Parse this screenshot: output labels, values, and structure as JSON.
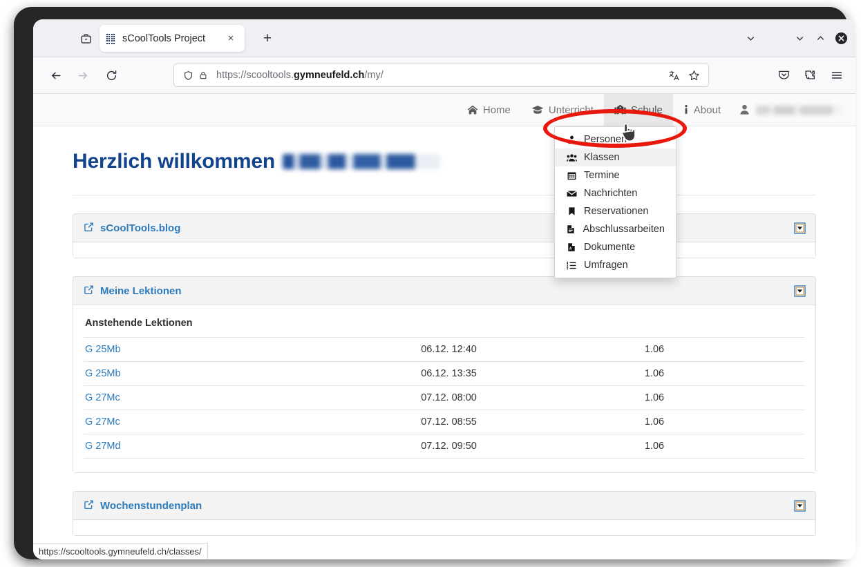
{
  "browser": {
    "tab": {
      "title": "sCoolTools Project",
      "favicon": "grid-favicon",
      "close_label": "×"
    },
    "new_tab_label": "+",
    "url": {
      "scheme": "https://scooltools.",
      "domain": "gymneufeld.ch",
      "path": "/my/"
    },
    "url_full": "https://scooltools.gymneufeld.ch/my/",
    "icons": {
      "tab_list": "chevron-down-icon",
      "minimize": "chevron-down-icon",
      "maximize": "chevron-up-icon",
      "close": "close-icon",
      "back": "arrow-left-icon",
      "forward": "arrow-right-icon",
      "reload": "reload-icon",
      "shield": "shield-icon",
      "lock": "lock-icon",
      "translate": "translate-icon",
      "bookmark": "star-icon",
      "pocket": "pocket-icon",
      "extensions": "extensions-icon",
      "menu": "hamburger-menu-icon"
    }
  },
  "site_nav": {
    "items": [
      {
        "label": "Home",
        "icon": "home-icon",
        "active": false
      },
      {
        "label": "Unterricht",
        "icon": "graduation-cap-icon",
        "active": false
      },
      {
        "label": "Schule",
        "icon": "school-icon",
        "active": true
      },
      {
        "label": "About",
        "icon": "info-icon",
        "active": false
      }
    ],
    "user": {
      "icon": "user-icon",
      "name_redacted": true
    }
  },
  "dropdown": {
    "open_for": "Schule",
    "items": [
      {
        "label": "Personen",
        "icon": "person-icon",
        "highlighted": false
      },
      {
        "label": "Klassen",
        "icon": "group-icon",
        "highlighted": true
      },
      {
        "label": "Termine",
        "icon": "calendar-icon",
        "highlighted": false
      },
      {
        "label": "Nachrichten",
        "icon": "envelope-icon",
        "highlighted": false
      },
      {
        "label": "Reservationen",
        "icon": "bookmark-icon",
        "highlighted": false
      },
      {
        "label": "Abschlussarbeiten",
        "icon": "file-text-icon",
        "highlighted": false
      },
      {
        "label": "Dokumente",
        "icon": "file-pdf-icon",
        "highlighted": false
      },
      {
        "label": "Umfragen",
        "icon": "list-ol-icon",
        "highlighted": false
      }
    ]
  },
  "page": {
    "welcome_prefix": "Herzlich willkommen",
    "welcome_name_redacted": true,
    "panels": [
      {
        "title": "sCoolTools.blog",
        "icon": "external-link-icon",
        "collapse_icon": "caret-down-box-icon"
      },
      {
        "title": "Meine Lektionen",
        "icon": "external-link-icon",
        "collapse_icon": "caret-down-box-icon"
      },
      {
        "title": "Wochenstundenplan",
        "icon": "external-link-icon",
        "collapse_icon": "caret-down-box-icon"
      }
    ],
    "lektionen": {
      "subtitle": "Anstehende Lektionen",
      "rows": [
        {
          "klasse": "G 25Mb",
          "zeit": "06.12. 12:40",
          "raum": "1.06"
        },
        {
          "klasse": "G 25Mb",
          "zeit": "06.12. 13:35",
          "raum": "1.06"
        },
        {
          "klasse": "G 27Mc",
          "zeit": "07.12. 08:00",
          "raum": "1.06"
        },
        {
          "klasse": "G 27Mc",
          "zeit": "07.12. 08:55",
          "raum": "1.06"
        },
        {
          "klasse": "G 27Md",
          "zeit": "07.12. 09:50",
          "raum": "1.06"
        }
      ]
    }
  },
  "status_bar": {
    "link": "https://scooltools.gymneufeld.ch/classes/"
  },
  "annotation": {
    "shape": "ellipse",
    "color": "#e8180c",
    "target": "Klassen"
  },
  "colors": {
    "brand_blue": "#11448c",
    "link_blue": "#2c7bbd",
    "annotation_red": "#e8180c",
    "panel_header": "#f3f3f3",
    "site_nav_bg": "#fafafa"
  }
}
